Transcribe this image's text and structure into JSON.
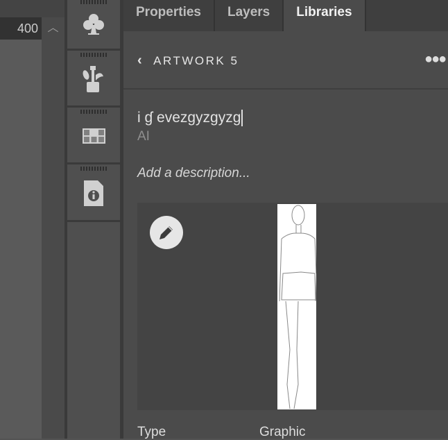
{
  "ruler": {
    "value": "400"
  },
  "tabs": [
    {
      "label": "Properties"
    },
    {
      "label": "Layers"
    },
    {
      "label": "Libraries"
    }
  ],
  "panel": {
    "title": "ARTWORK 5",
    "asset_name": "i ɠ evezgyzgyzg",
    "asset_type": "AI",
    "description_placeholder": "Add a description...",
    "type_label": "Type",
    "type_value": "Graphic"
  },
  "icons": [
    "club-icon",
    "brushes-icon",
    "swatches-grid-icon",
    "document-info-icon"
  ]
}
